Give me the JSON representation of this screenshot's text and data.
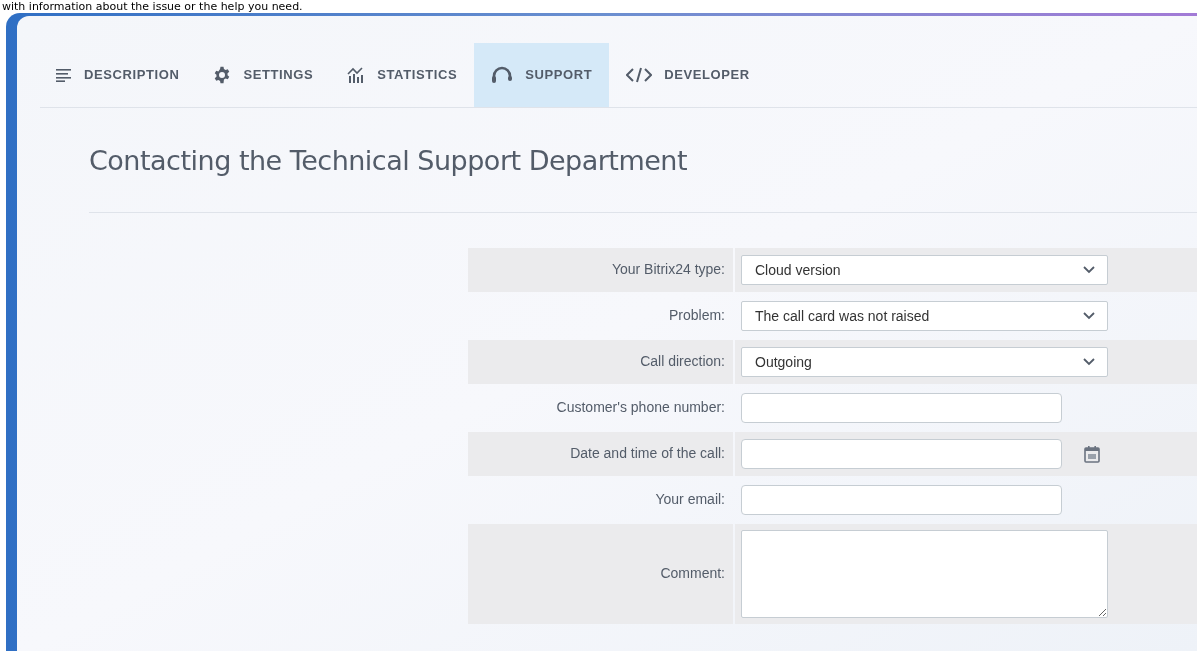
{
  "intro_text": "with information about the issue or the help you need.",
  "tabs": [
    {
      "label": "DESCRIPTION",
      "kind": "lines",
      "selected": false
    },
    {
      "label": "SETTINGS",
      "kind": "gear",
      "selected": false
    },
    {
      "label": "STATISTICS",
      "kind": "chart",
      "selected": false
    },
    {
      "label": "SUPPORT",
      "kind": "headset",
      "selected": true
    },
    {
      "label": "DEVELOPER",
      "kind": "code",
      "selected": false
    }
  ],
  "heading": "Contacting the Technical Support Department",
  "form": [
    {
      "label": "Your Bitrix24 type:",
      "kind": "select",
      "value": "Cloud version"
    },
    {
      "label": "Problem:",
      "kind": "select",
      "value": "The call card was not raised"
    },
    {
      "label": "Call direction:",
      "kind": "select",
      "value": "Outgoing"
    },
    {
      "label": "Customer's phone number:",
      "kind": "text"
    },
    {
      "label": "Date and time of the call:",
      "kind": "date"
    },
    {
      "label": "Your email:",
      "kind": "text"
    },
    {
      "label": "Comment:",
      "kind": "textarea"
    }
  ]
}
